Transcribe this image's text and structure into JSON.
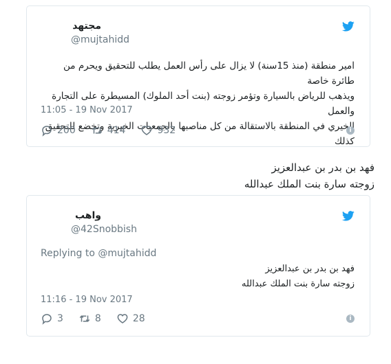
{
  "tweet1": {
    "author_name": "مجتهد",
    "handle": "@mujtahidd",
    "body_lines": [
      "امير منطقة (منذ 15سنة) لا يزال على رأس العمل يطلب للتحقيق ويحرم من طائرة خاصة",
      "ويذهب للرياض بالسيارة وتؤمر زوجته (بنت أحد الملوك) المسيطرة على التجارة والعمل",
      "الخيري في المنطقة بالاستقالة من كل مناصبها بالجمعيات الخيرية وتخضع للتحقيق كذلك"
    ],
    "timestamp": "11:05 - 19 Nov 2017",
    "replies": "200",
    "retweets": "414",
    "likes": "932"
  },
  "page_text": {
    "line1": "فهد بن بدر بن عبدالعزيز",
    "line2": "زوجته سارة بنت الملك عبدالله"
  },
  "tweet2": {
    "author_name": "واهب",
    "handle": "@42Snobbish",
    "reply_to": "Replying to @mujtahidd",
    "body_lines": [
      "فهد بن بدر بن عبدالعزيز",
      "زوجته سارة بنت الملك عبدالله"
    ],
    "timestamp": "11:16 - 19 Nov 2017",
    "replies": "3",
    "retweets": "8",
    "likes": "28"
  },
  "icons": {
    "bird": "twitter-bird-icon",
    "reply": "reply-icon",
    "retweet": "retweet-icon",
    "like": "heart-icon",
    "info": "info-icon"
  },
  "colors": {
    "twitter_blue": "#1da1f2",
    "muted": "#697882",
    "border": "#e1e8ed"
  }
}
